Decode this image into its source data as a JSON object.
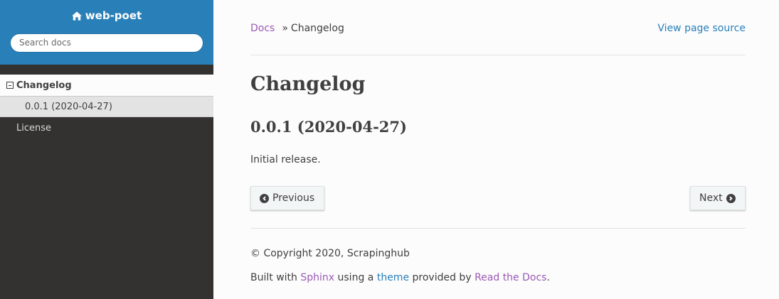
{
  "sidebar": {
    "brand": "web-poet",
    "search_placeholder": "Search docs",
    "nav": {
      "current_l1": "Changelog",
      "current_l2": "0.0.1 (2020-04-27)",
      "other_l1": "License"
    }
  },
  "breadcrumbs": {
    "docs": "Docs",
    "separator": "»",
    "current": "Changelog",
    "view_source": "View page source"
  },
  "page": {
    "title": "Changelog",
    "section_heading": "0.0.1 (2020-04-27)",
    "paragraph": "Initial release."
  },
  "pager": {
    "previous": "Previous",
    "next": "Next"
  },
  "footer": {
    "copyright": "© Copyright 2020, Scrapinghub",
    "built_with": "Built with",
    "sphinx": "Sphinx",
    "using_a": "using a",
    "theme": "theme",
    "provided_by": "provided by",
    "rtd": "Read the Docs",
    "period": "."
  },
  "colors": {
    "sidebar_header": "#2980b9",
    "sidebar_bg": "#343131",
    "link_visited": "#9b59b6",
    "link": "#2980b9"
  }
}
